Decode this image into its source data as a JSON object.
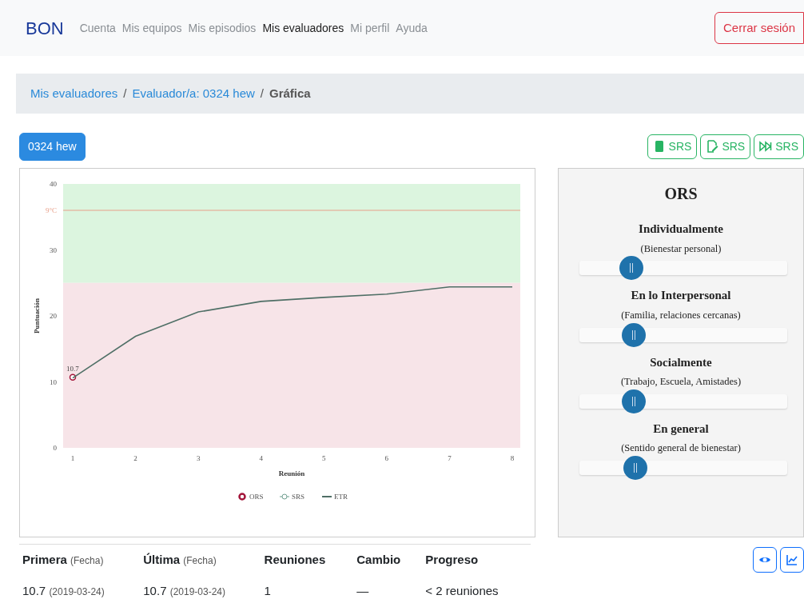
{
  "navbar": {
    "brand": "BON",
    "items": [
      {
        "label": "Cuenta",
        "selected": false
      },
      {
        "label": "Mis equipos",
        "selected": false
      },
      {
        "label": "Mis episodios",
        "selected": false
      },
      {
        "label": "Mis evaluadores",
        "selected": true
      },
      {
        "label": "Mi perfil",
        "selected": false
      },
      {
        "label": "Ayuda",
        "selected": false
      }
    ],
    "logout": "Cerrar sesión"
  },
  "breadcrumb": [
    {
      "kind": "link",
      "label": "Mis evaluadores"
    },
    {
      "kind": "separator",
      "label": "/"
    },
    {
      "kind": "link",
      "label": "Evaluador/a: 0324 hew"
    },
    {
      "kind": "separator",
      "label": "/"
    },
    {
      "kind": "current",
      "label": "Gráfica"
    }
  ],
  "evaluator_badge": "0324 hew",
  "srs_buttons": [
    {
      "kind": "tablet",
      "label": "SRS"
    },
    {
      "kind": "edit",
      "label": "SRS"
    },
    {
      "kind": "skip",
      "label": "SRS"
    }
  ],
  "chart": {
    "chart_data": {
      "type": "line",
      "xlabel": "Reunión",
      "ylabel": "Puntuación",
      "categories": [
        "1",
        "2",
        "3",
        "4",
        "5",
        "6",
        "7",
        "8"
      ],
      "series": [
        {
          "name": "ORS",
          "color": "#a3153a",
          "marker": "circle",
          "values": [
            10.7,
            null,
            null,
            null,
            null,
            null,
            null,
            null
          ]
        },
        {
          "name": "SRS",
          "color": "#6f9f8f",
          "marker": "circle",
          "values": [
            null,
            null,
            null,
            null,
            null,
            null,
            null,
            null
          ]
        },
        {
          "name": "ETR",
          "color": "#4f6f66",
          "marker": "none",
          "values": [
            10.6,
            16.9,
            20.6,
            22.2,
            22.8,
            23.3,
            24.4,
            24.4
          ]
        }
      ],
      "ylim": [
        0,
        40
      ],
      "yticks": [
        0,
        10,
        20,
        30,
        40
      ],
      "legend": "bottom",
      "bands": [
        {
          "axis": "y",
          "from": 25,
          "to": 40,
          "color": "#dcf5df"
        },
        {
          "axis": "y",
          "from": 0,
          "to": 25,
          "color": "#f7e4e8"
        }
      ],
      "ref_lines": [
        {
          "axis": "y",
          "value": 36,
          "label": "9°C",
          "color": "#e8a08a"
        }
      ],
      "annotations": [
        {
          "x": "1",
          "y": 10.7,
          "text": "10.7"
        }
      ]
    }
  },
  "ors_panel": {
    "title": "ORS",
    "scales": [
      {
        "title": "Individualmente",
        "subtitle": "(Bienestar personal)",
        "level": 0.25
      },
      {
        "title": "En lo Interpersonal",
        "subtitle": "(Familia, relaciones cercanas)",
        "level": 0.26
      },
      {
        "title": "Socialmente",
        "subtitle": "(Trabajo, Escuela, Amistades)",
        "level": 0.26
      },
      {
        "title": "En general",
        "subtitle": "(Sentido general de bienestar)",
        "level": 0.27
      }
    ]
  },
  "view_buttons": [
    {
      "kind": "eye"
    },
    {
      "kind": "chart"
    }
  ],
  "table": {
    "columns": [
      {
        "label": "Primera",
        "note": "(Fecha)"
      },
      {
        "label": "Última",
        "note": "(Fecha)"
      },
      {
        "label": "Reuniones"
      },
      {
        "label": "Cambio"
      },
      {
        "label": "Progreso"
      }
    ],
    "rows": [
      [
        {
          "value": "10.7",
          "note": "(2019-03-24)"
        },
        {
          "value": "10.7",
          "note": "(2019-03-24)"
        },
        {
          "value": "1"
        },
        {
          "value": "—"
        },
        {
          "value": "< 2 reuniones"
        }
      ]
    ]
  }
}
